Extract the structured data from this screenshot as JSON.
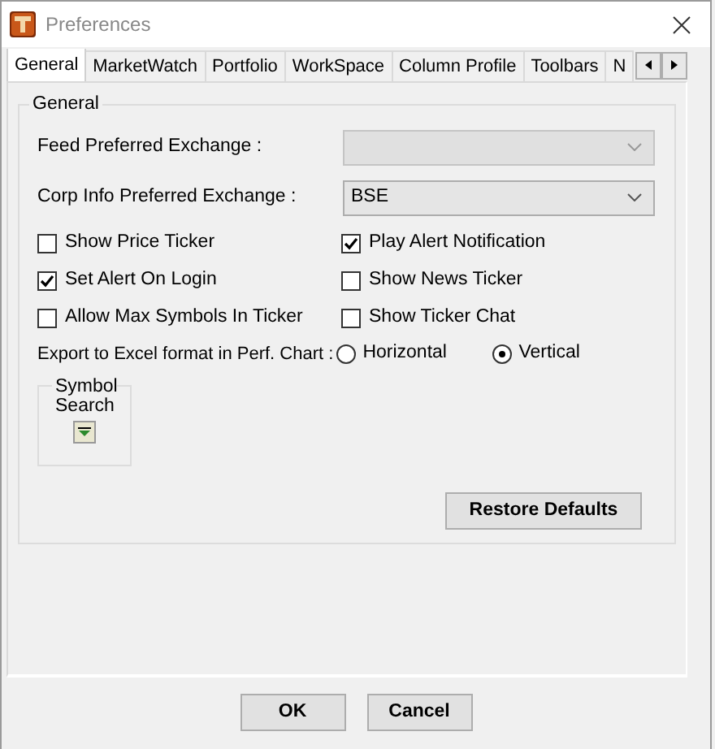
{
  "window": {
    "title": "Preferences"
  },
  "tabs": [
    {
      "label": "General",
      "selected": true
    },
    {
      "label": "MarketWatch",
      "selected": false
    },
    {
      "label": "Portfolio",
      "selected": false
    },
    {
      "label": "WorkSpace",
      "selected": false
    },
    {
      "label": "Column Profile",
      "selected": false
    },
    {
      "label": "Toolbars",
      "selected": false
    },
    {
      "label": "N",
      "selected": false
    }
  ],
  "group": {
    "title": "General"
  },
  "fields": [
    {
      "label": "Feed Preferred Exchange :",
      "disabled": true
    },
    {
      "label": "Corp Info Preferred Exchange :",
      "value": "BSE",
      "disabled": false
    }
  ],
  "checkboxes": [
    {
      "label": "Show Price Ticker",
      "checked": false
    },
    {
      "label": "Play Alert Notification",
      "checked": true
    },
    {
      "label": "Set Alert On Login",
      "checked": true
    },
    {
      "label": "Show News Ticker",
      "checked": false
    },
    {
      "label": "Allow Max Symbols In Ticker",
      "checked": false
    },
    {
      "label": "Show Ticker Chat",
      "checked": false
    }
  ],
  "export": {
    "label": "Export to Excel format in Perf. Chart :",
    "options": [
      {
        "label": "Horizontal",
        "selected": false
      },
      {
        "label": "Vertical",
        "selected": true
      }
    ]
  },
  "symbol_search": {
    "title": "Symbol Search"
  },
  "restore_button": "Restore Defaults",
  "buttons": [
    "OK",
    "Cancel"
  ]
}
